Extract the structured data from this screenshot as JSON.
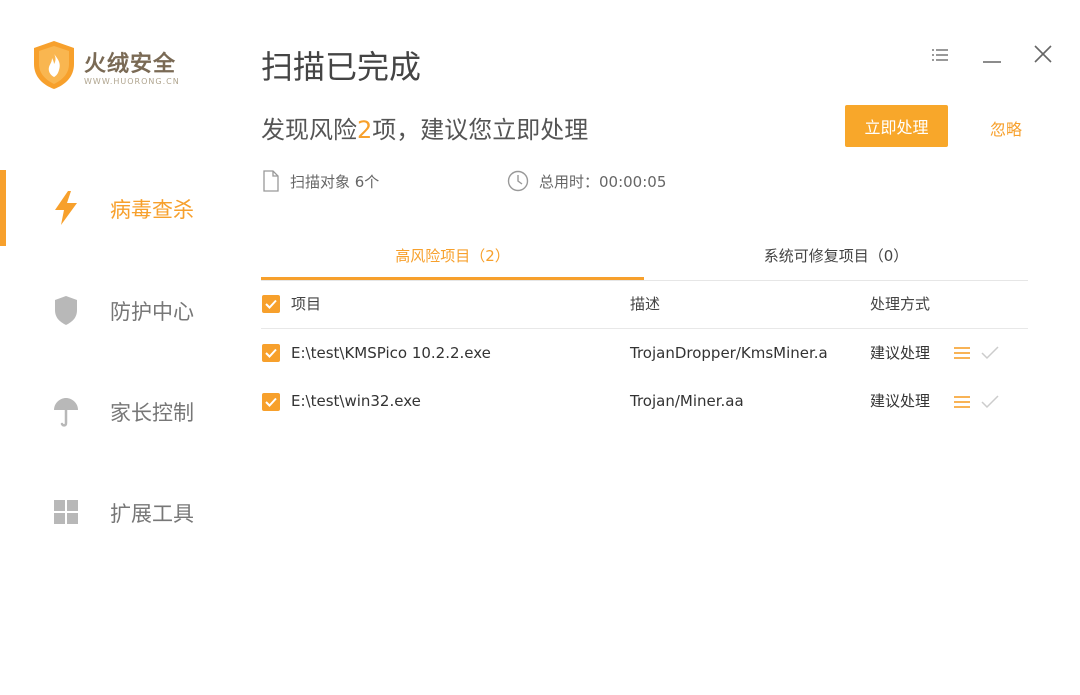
{
  "app": {
    "name": "火绒安全",
    "url": "WWW.HUORONG.CN"
  },
  "colors": {
    "accent": "#f7a02c",
    "primary_button": "#f8a72a",
    "nav_inactive": "#777777"
  },
  "sidebar": {
    "items": [
      {
        "label": "病毒查杀",
        "icon": "lightning-icon",
        "active": true
      },
      {
        "label": "防护中心",
        "icon": "shield-icon",
        "active": false
      },
      {
        "label": "家长控制",
        "icon": "umbrella-icon",
        "active": false
      },
      {
        "label": "扩展工具",
        "icon": "grid-icon",
        "active": false
      }
    ]
  },
  "window_controls": [
    "menu-icon",
    "minimize-icon",
    "close-icon"
  ],
  "header": {
    "title": "扫描已完成",
    "subtitle_prefix": "发现风险",
    "subtitle_count": "2",
    "subtitle_suffix": "项，建议您立即处理",
    "primary_button": "立即处理",
    "ignore_link": "忽略"
  },
  "scan_info": {
    "objects": "扫描对象 6个",
    "time": "总用时：00:00:05"
  },
  "tabs": [
    {
      "label": "高风险项目（2）",
      "active": true
    },
    {
      "label": "系统可修复项目（0）",
      "active": false
    }
  ],
  "table": {
    "columns": [
      "项目",
      "描述",
      "处理方式"
    ],
    "rows": [
      {
        "item": "E:\\test\\KMSPico 10.2.2.exe",
        "description": "TrojanDropper/KmsMiner.a",
        "action": "建议处理",
        "checked": true
      },
      {
        "item": "E:\\test\\win32.exe",
        "description": "Trojan/Miner.aa",
        "action": "建议处理",
        "checked": true
      }
    ]
  }
}
